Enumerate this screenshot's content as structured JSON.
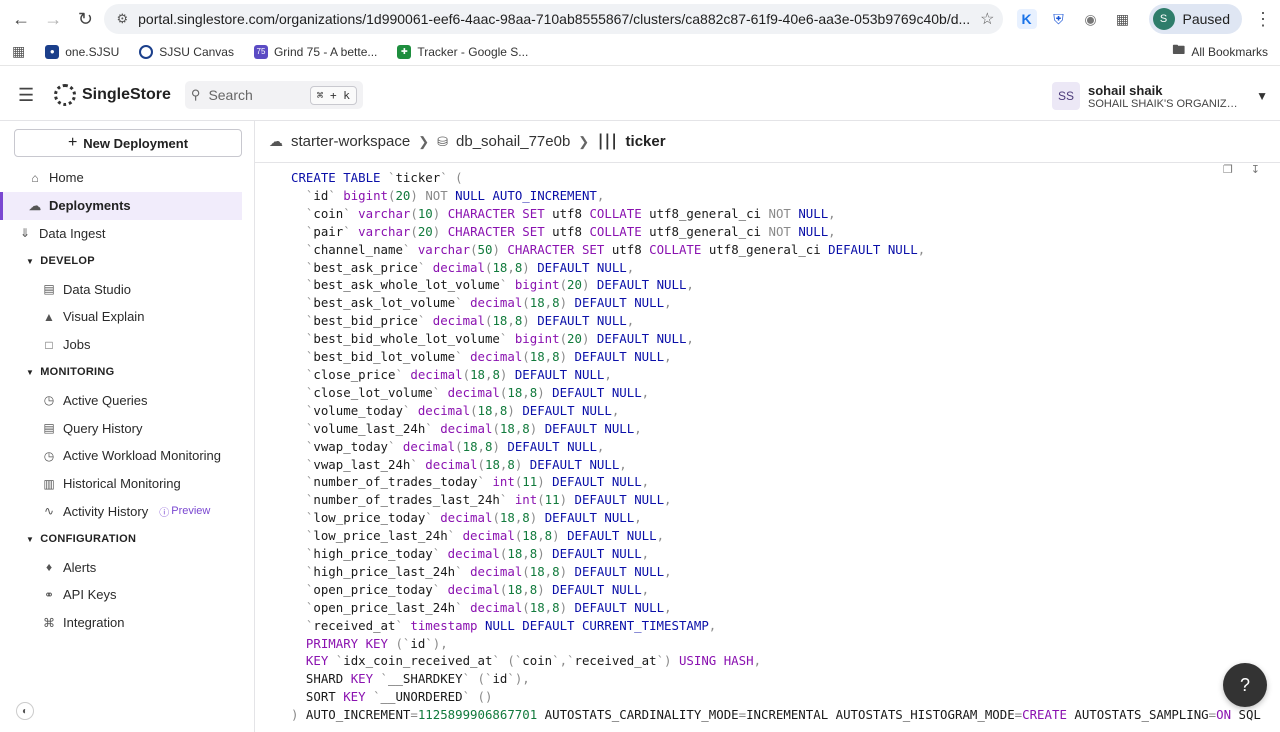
{
  "browser": {
    "url": "portal.singlestore.com/organizations/1d990061-eef6-4aac-98aa-710ab8555867/clusters/ca882c87-61f9-40e6-aa3e-053b9769c40b/d...",
    "profile_label": "Paused",
    "profile_initial": "S",
    "bookmarks": [
      "one.SJSU",
      "SJSU Canvas",
      "Grind 75 - A bette...",
      "Tracker - Google S..."
    ],
    "bookmark_grind_badge": "75",
    "all_bookmarks": "All Bookmarks"
  },
  "header": {
    "logo_text": "SingleStore",
    "search_placeholder": "Search",
    "search_shortcut": "⌘ + k",
    "user_initials": "SS",
    "user_name": "sohail shaik",
    "org_name": "SOHAIL SHAIK'S ORGANIZA..."
  },
  "sidebar": {
    "new_deployment": "New Deployment",
    "items": {
      "home": "Home",
      "deployments": "Deployments",
      "data_ingest": "Data Ingest"
    },
    "develop": {
      "title": "DEVELOP",
      "items": [
        "Data Studio",
        "Visual Explain",
        "Jobs"
      ]
    },
    "monitoring": {
      "title": "MONITORING",
      "items": [
        "Active Queries",
        "Query History",
        "Active Workload Monitoring",
        "Historical Monitoring",
        "Activity History"
      ],
      "preview_badge": "Preview"
    },
    "configuration": {
      "title": "CONFIGURATION",
      "items": [
        "Alerts",
        "API Keys",
        "Integration"
      ]
    }
  },
  "breadcrumb": {
    "workspace": "starter-workspace",
    "database": "db_sohail_77e0b",
    "table": "ticker"
  },
  "ddl_lines": [
    [
      [
        "kw",
        "CREATE TABLE "
      ],
      [
        "pn",
        "`"
      ],
      [
        "id",
        "ticker"
      ],
      [
        "pn",
        "` ("
      ]
    ],
    [
      [
        "pn",
        "  `"
      ],
      [
        "id",
        "id"
      ],
      [
        "pn",
        "` "
      ],
      [
        "ty",
        "bigint"
      ],
      [
        "pn",
        "("
      ],
      [
        "nm",
        "20"
      ],
      [
        "pn",
        ") "
      ],
      [
        "pn",
        "NOT "
      ],
      [
        "kw",
        "NULL AUTO_INCREMENT"
      ],
      [
        "pn",
        ","
      ]
    ],
    [
      [
        "pn",
        "  `"
      ],
      [
        "id",
        "coin"
      ],
      [
        "pn",
        "` "
      ],
      [
        "ty",
        "varchar"
      ],
      [
        "pn",
        "("
      ],
      [
        "nm",
        "10"
      ],
      [
        "pn",
        ") "
      ],
      [
        "ty",
        "CHARACTER SET "
      ],
      [
        "id",
        "utf8 "
      ],
      [
        "ty",
        "COLLATE "
      ],
      [
        "id",
        "utf8_general_ci "
      ],
      [
        "pn",
        "NOT "
      ],
      [
        "kw",
        "NULL"
      ],
      [
        "pn",
        ","
      ]
    ],
    [
      [
        "pn",
        "  `"
      ],
      [
        "id",
        "pair"
      ],
      [
        "pn",
        "` "
      ],
      [
        "ty",
        "varchar"
      ],
      [
        "pn",
        "("
      ],
      [
        "nm",
        "20"
      ],
      [
        "pn",
        ") "
      ],
      [
        "ty",
        "CHARACTER SET "
      ],
      [
        "id",
        "utf8 "
      ],
      [
        "ty",
        "COLLATE "
      ],
      [
        "id",
        "utf8_general_ci "
      ],
      [
        "pn",
        "NOT "
      ],
      [
        "kw",
        "NULL"
      ],
      [
        "pn",
        ","
      ]
    ],
    [
      [
        "pn",
        "  `"
      ],
      [
        "id",
        "channel_name"
      ],
      [
        "pn",
        "` "
      ],
      [
        "ty",
        "varchar"
      ],
      [
        "pn",
        "("
      ],
      [
        "nm",
        "50"
      ],
      [
        "pn",
        ") "
      ],
      [
        "ty",
        "CHARACTER SET "
      ],
      [
        "id",
        "utf8 "
      ],
      [
        "ty",
        "COLLATE "
      ],
      [
        "id",
        "utf8_general_ci "
      ],
      [
        "kw",
        "DEFAULT NULL"
      ],
      [
        "pn",
        ","
      ]
    ],
    [
      [
        "pn",
        "  `"
      ],
      [
        "id",
        "best_ask_price"
      ],
      [
        "pn",
        "` "
      ],
      [
        "ty",
        "decimal"
      ],
      [
        "pn",
        "("
      ],
      [
        "nm",
        "18"
      ],
      [
        "pn",
        ","
      ],
      [
        "nm",
        "8"
      ],
      [
        "pn",
        ") "
      ],
      [
        "kw",
        "DEFAULT NULL"
      ],
      [
        "pn",
        ","
      ]
    ],
    [
      [
        "pn",
        "  `"
      ],
      [
        "id",
        "best_ask_whole_lot_volume"
      ],
      [
        "pn",
        "` "
      ],
      [
        "ty",
        "bigint"
      ],
      [
        "pn",
        "("
      ],
      [
        "nm",
        "20"
      ],
      [
        "pn",
        ") "
      ],
      [
        "kw",
        "DEFAULT NULL"
      ],
      [
        "pn",
        ","
      ]
    ],
    [
      [
        "pn",
        "  `"
      ],
      [
        "id",
        "best_ask_lot_volume"
      ],
      [
        "pn",
        "` "
      ],
      [
        "ty",
        "decimal"
      ],
      [
        "pn",
        "("
      ],
      [
        "nm",
        "18"
      ],
      [
        "pn",
        ","
      ],
      [
        "nm",
        "8"
      ],
      [
        "pn",
        ") "
      ],
      [
        "kw",
        "DEFAULT NULL"
      ],
      [
        "pn",
        ","
      ]
    ],
    [
      [
        "pn",
        "  `"
      ],
      [
        "id",
        "best_bid_price"
      ],
      [
        "pn",
        "` "
      ],
      [
        "ty",
        "decimal"
      ],
      [
        "pn",
        "("
      ],
      [
        "nm",
        "18"
      ],
      [
        "pn",
        ","
      ],
      [
        "nm",
        "8"
      ],
      [
        "pn",
        ") "
      ],
      [
        "kw",
        "DEFAULT NULL"
      ],
      [
        "pn",
        ","
      ]
    ],
    [
      [
        "pn",
        "  `"
      ],
      [
        "id",
        "best_bid_whole_lot_volume"
      ],
      [
        "pn",
        "` "
      ],
      [
        "ty",
        "bigint"
      ],
      [
        "pn",
        "("
      ],
      [
        "nm",
        "20"
      ],
      [
        "pn",
        ") "
      ],
      [
        "kw",
        "DEFAULT NULL"
      ],
      [
        "pn",
        ","
      ]
    ],
    [
      [
        "pn",
        "  `"
      ],
      [
        "id",
        "best_bid_lot_volume"
      ],
      [
        "pn",
        "` "
      ],
      [
        "ty",
        "decimal"
      ],
      [
        "pn",
        "("
      ],
      [
        "nm",
        "18"
      ],
      [
        "pn",
        ","
      ],
      [
        "nm",
        "8"
      ],
      [
        "pn",
        ") "
      ],
      [
        "kw",
        "DEFAULT NULL"
      ],
      [
        "pn",
        ","
      ]
    ],
    [
      [
        "pn",
        "  `"
      ],
      [
        "id",
        "close_price"
      ],
      [
        "pn",
        "` "
      ],
      [
        "ty",
        "decimal"
      ],
      [
        "pn",
        "("
      ],
      [
        "nm",
        "18"
      ],
      [
        "pn",
        ","
      ],
      [
        "nm",
        "8"
      ],
      [
        "pn",
        ") "
      ],
      [
        "kw",
        "DEFAULT NULL"
      ],
      [
        "pn",
        ","
      ]
    ],
    [
      [
        "pn",
        "  `"
      ],
      [
        "id",
        "close_lot_volume"
      ],
      [
        "pn",
        "` "
      ],
      [
        "ty",
        "decimal"
      ],
      [
        "pn",
        "("
      ],
      [
        "nm",
        "18"
      ],
      [
        "pn",
        ","
      ],
      [
        "nm",
        "8"
      ],
      [
        "pn",
        ") "
      ],
      [
        "kw",
        "DEFAULT NULL"
      ],
      [
        "pn",
        ","
      ]
    ],
    [
      [
        "pn",
        "  `"
      ],
      [
        "id",
        "volume_today"
      ],
      [
        "pn",
        "` "
      ],
      [
        "ty",
        "decimal"
      ],
      [
        "pn",
        "("
      ],
      [
        "nm",
        "18"
      ],
      [
        "pn",
        ","
      ],
      [
        "nm",
        "8"
      ],
      [
        "pn",
        ") "
      ],
      [
        "kw",
        "DEFAULT NULL"
      ],
      [
        "pn",
        ","
      ]
    ],
    [
      [
        "pn",
        "  `"
      ],
      [
        "id",
        "volume_last_24h"
      ],
      [
        "pn",
        "` "
      ],
      [
        "ty",
        "decimal"
      ],
      [
        "pn",
        "("
      ],
      [
        "nm",
        "18"
      ],
      [
        "pn",
        ","
      ],
      [
        "nm",
        "8"
      ],
      [
        "pn",
        ") "
      ],
      [
        "kw",
        "DEFAULT NULL"
      ],
      [
        "pn",
        ","
      ]
    ],
    [
      [
        "pn",
        "  `"
      ],
      [
        "id",
        "vwap_today"
      ],
      [
        "pn",
        "` "
      ],
      [
        "ty",
        "decimal"
      ],
      [
        "pn",
        "("
      ],
      [
        "nm",
        "18"
      ],
      [
        "pn",
        ","
      ],
      [
        "nm",
        "8"
      ],
      [
        "pn",
        ") "
      ],
      [
        "kw",
        "DEFAULT NULL"
      ],
      [
        "pn",
        ","
      ]
    ],
    [
      [
        "pn",
        "  `"
      ],
      [
        "id",
        "vwap_last_24h"
      ],
      [
        "pn",
        "` "
      ],
      [
        "ty",
        "decimal"
      ],
      [
        "pn",
        "("
      ],
      [
        "nm",
        "18"
      ],
      [
        "pn",
        ","
      ],
      [
        "nm",
        "8"
      ],
      [
        "pn",
        ") "
      ],
      [
        "kw",
        "DEFAULT NULL"
      ],
      [
        "pn",
        ","
      ]
    ],
    [
      [
        "pn",
        "  `"
      ],
      [
        "id",
        "number_of_trades_today"
      ],
      [
        "pn",
        "` "
      ],
      [
        "ty",
        "int"
      ],
      [
        "pn",
        "("
      ],
      [
        "nm",
        "11"
      ],
      [
        "pn",
        ") "
      ],
      [
        "kw",
        "DEFAULT NULL"
      ],
      [
        "pn",
        ","
      ]
    ],
    [
      [
        "pn",
        "  `"
      ],
      [
        "id",
        "number_of_trades_last_24h"
      ],
      [
        "pn",
        "` "
      ],
      [
        "ty",
        "int"
      ],
      [
        "pn",
        "("
      ],
      [
        "nm",
        "11"
      ],
      [
        "pn",
        ") "
      ],
      [
        "kw",
        "DEFAULT NULL"
      ],
      [
        "pn",
        ","
      ]
    ],
    [
      [
        "pn",
        "  `"
      ],
      [
        "id",
        "low_price_today"
      ],
      [
        "pn",
        "` "
      ],
      [
        "ty",
        "decimal"
      ],
      [
        "pn",
        "("
      ],
      [
        "nm",
        "18"
      ],
      [
        "pn",
        ","
      ],
      [
        "nm",
        "8"
      ],
      [
        "pn",
        ") "
      ],
      [
        "kw",
        "DEFAULT NULL"
      ],
      [
        "pn",
        ","
      ]
    ],
    [
      [
        "pn",
        "  `"
      ],
      [
        "id",
        "low_price_last_24h"
      ],
      [
        "pn",
        "` "
      ],
      [
        "ty",
        "decimal"
      ],
      [
        "pn",
        "("
      ],
      [
        "nm",
        "18"
      ],
      [
        "pn",
        ","
      ],
      [
        "nm",
        "8"
      ],
      [
        "pn",
        ") "
      ],
      [
        "kw",
        "DEFAULT NULL"
      ],
      [
        "pn",
        ","
      ]
    ],
    [
      [
        "pn",
        "  `"
      ],
      [
        "id",
        "high_price_today"
      ],
      [
        "pn",
        "` "
      ],
      [
        "ty",
        "decimal"
      ],
      [
        "pn",
        "("
      ],
      [
        "nm",
        "18"
      ],
      [
        "pn",
        ","
      ],
      [
        "nm",
        "8"
      ],
      [
        "pn",
        ") "
      ],
      [
        "kw",
        "DEFAULT NULL"
      ],
      [
        "pn",
        ","
      ]
    ],
    [
      [
        "pn",
        "  `"
      ],
      [
        "id",
        "high_price_last_24h"
      ],
      [
        "pn",
        "` "
      ],
      [
        "ty",
        "decimal"
      ],
      [
        "pn",
        "("
      ],
      [
        "nm",
        "18"
      ],
      [
        "pn",
        ","
      ],
      [
        "nm",
        "8"
      ],
      [
        "pn",
        ") "
      ],
      [
        "kw",
        "DEFAULT NULL"
      ],
      [
        "pn",
        ","
      ]
    ],
    [
      [
        "pn",
        "  `"
      ],
      [
        "id",
        "open_price_today"
      ],
      [
        "pn",
        "` "
      ],
      [
        "ty",
        "decimal"
      ],
      [
        "pn",
        "("
      ],
      [
        "nm",
        "18"
      ],
      [
        "pn",
        ","
      ],
      [
        "nm",
        "8"
      ],
      [
        "pn",
        ") "
      ],
      [
        "kw",
        "DEFAULT NULL"
      ],
      [
        "pn",
        ","
      ]
    ],
    [
      [
        "pn",
        "  `"
      ],
      [
        "id",
        "open_price_last_24h"
      ],
      [
        "pn",
        "` "
      ],
      [
        "ty",
        "decimal"
      ],
      [
        "pn",
        "("
      ],
      [
        "nm",
        "18"
      ],
      [
        "pn",
        ","
      ],
      [
        "nm",
        "8"
      ],
      [
        "pn",
        ") "
      ],
      [
        "kw",
        "DEFAULT NULL"
      ],
      [
        "pn",
        ","
      ]
    ],
    [
      [
        "pn",
        "  `"
      ],
      [
        "id",
        "received_at"
      ],
      [
        "pn",
        "` "
      ],
      [
        "ty",
        "timestamp "
      ],
      [
        "kw",
        "NULL DEFAULT CURRENT_TIMESTAMP"
      ],
      [
        "pn",
        ","
      ]
    ],
    [
      [
        "ty",
        "  PRIMARY KEY "
      ],
      [
        "pn",
        "(`"
      ],
      [
        "id",
        "id"
      ],
      [
        "pn",
        "`),"
      ]
    ],
    [
      [
        "ty",
        "  KEY "
      ],
      [
        "pn",
        "`"
      ],
      [
        "id",
        "idx_coin_received_at"
      ],
      [
        "pn",
        "` (`"
      ],
      [
        "id",
        "coin"
      ],
      [
        "pn",
        "`,`"
      ],
      [
        "id",
        "received_at"
      ],
      [
        "pn",
        "`) "
      ],
      [
        "ty",
        "USING HASH"
      ],
      [
        "pn",
        ","
      ]
    ],
    [
      [
        "id",
        "  SHARD "
      ],
      [
        "ty",
        "KEY "
      ],
      [
        "pn",
        "`"
      ],
      [
        "id",
        "__SHARDKEY"
      ],
      [
        "pn",
        "` (`"
      ],
      [
        "id",
        "id"
      ],
      [
        "pn",
        "`),"
      ]
    ],
    [
      [
        "id",
        "  SORT "
      ],
      [
        "ty",
        "KEY "
      ],
      [
        "pn",
        "`"
      ],
      [
        "id",
        "__UNORDERED"
      ],
      [
        "pn",
        "` ()"
      ]
    ],
    [
      [
        "pn",
        ") "
      ],
      [
        "id",
        "AUTO_INCREMENT"
      ],
      [
        "pn",
        "="
      ],
      [
        "nm",
        "1125899906867701 "
      ],
      [
        "id",
        "AUTOSTATS_CARDINALITY_MODE"
      ],
      [
        "pn",
        "="
      ],
      [
        "id",
        "INCREMENTAL "
      ],
      [
        "id",
        "AUTOSTATS_HISTOGRAM_MODE"
      ],
      [
        "pn",
        "="
      ],
      [
        "ty",
        "CREATE "
      ],
      [
        "id",
        "AUTOSTATS_SAMPLING"
      ],
      [
        "pn",
        "="
      ],
      [
        "ty",
        "ON "
      ],
      [
        "id",
        "SQL"
      ]
    ]
  ]
}
